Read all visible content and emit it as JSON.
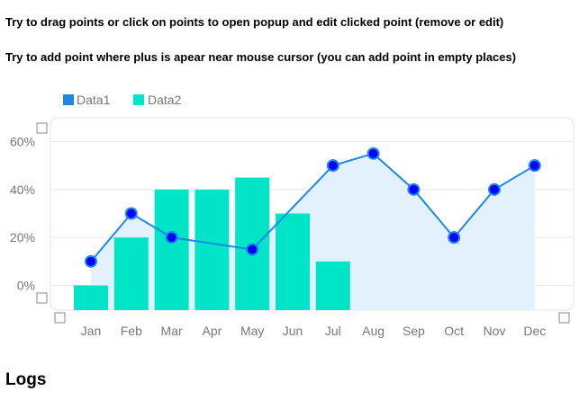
{
  "instructions": {
    "line1": "Try to drag points or click on points to open popup and edit clicked point (remove or edit)",
    "line2": "Try to add point where plus is apear near mouse cursor (you can add point in empty places)"
  },
  "logs_heading": "Logs",
  "colors": {
    "data1_line": "#1e88e5",
    "data1_point_fill": "#0000ff",
    "data1_area": "#e3f1fd",
    "data2_bar": "#00e5c8",
    "axis_text": "#777777",
    "grid": "#e8e8e8"
  },
  "chart_data": {
    "type": "bar",
    "categories": [
      "Jan",
      "Feb",
      "Mar",
      "Apr",
      "May",
      "Jun",
      "Jul",
      "Aug",
      "Sep",
      "Oct",
      "Nov",
      "Dec"
    ],
    "y_ticks": [
      "60%",
      "40%",
      "20%",
      "0%"
    ],
    "y_tick_values": [
      60,
      40,
      20,
      0
    ],
    "ylim": [
      -10,
      70
    ],
    "legend_position": "top-left",
    "series": [
      {
        "name": "Data1",
        "kind": "line-area",
        "values": [
          10,
          30,
          20,
          null,
          15,
          null,
          50,
          55,
          40,
          20,
          40,
          50
        ]
      },
      {
        "name": "Data2",
        "kind": "bar",
        "values": [
          0,
          20,
          40,
          40,
          45,
          30,
          10,
          null,
          null,
          null,
          null,
          null
        ]
      }
    ]
  }
}
